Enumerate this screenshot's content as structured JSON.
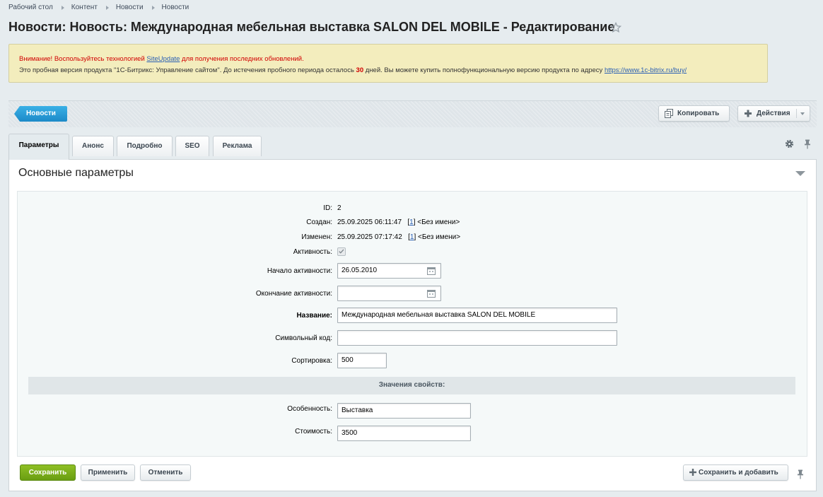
{
  "breadcrumb": [
    "Рабочий стол",
    "Контент",
    "Новости",
    "Новости"
  ],
  "page_title": "Новости: Новость: Международная мебельная выставка SALON DEL MOBILE - Редактирование",
  "notice": {
    "warning_prefix": "Внимание! Воспользуйтесь технологией ",
    "warning_link": "SiteUpdate",
    "warning_suffix": " для получения последних обновлений.",
    "info_prefix": "Это пробная версия продукта \"1С-Битрикс: Управление сайтом\". До истечения пробного периода осталось ",
    "days": "30",
    "info_middle": " дней. Вы можете купить полнофункциональную версию продукта по адресу ",
    "info_link": "https://www.1c-bitrix.ru/buy/"
  },
  "toolbar": {
    "back_label": "Новости",
    "copy_label": "Копировать",
    "actions_label": "Действия"
  },
  "tabs": [
    "Параметры",
    "Анонс",
    "Подробно",
    "SEO",
    "Реклама"
  ],
  "section_title": "Основные параметры",
  "form": {
    "id_label": "ID:",
    "id_value": "2",
    "created_label": "Создан:",
    "created_date": "25.09.2025 06:11:47",
    "created_user_link": "1",
    "created_user": "<Без имени>",
    "modified_label": "Изменен:",
    "modified_date": "25.09.2025 07:17:42",
    "modified_user_link": "1",
    "modified_user": "<Без имени>",
    "active_label": "Активность:",
    "active_checked": true,
    "start_label": "Начало активности:",
    "start_value": "26.05.2010",
    "end_label": "Окончание активности:",
    "end_value": "",
    "name_label": "Название:",
    "name_value": "Международная мебельная выставка SALON DEL MOBILE",
    "code_label": "Символьный код:",
    "code_value": "",
    "sort_label": "Сортировка:",
    "sort_value": "500",
    "props_header": "Значения свойств:",
    "feature_label": "Особенность:",
    "feature_value": "Выставка",
    "price_label": "Стоимость:",
    "price_value": "3500"
  },
  "footer": {
    "save_label": "Сохранить",
    "apply_label": "Применить",
    "cancel_label": "Отменить",
    "save_add_label": "Сохранить и добавить"
  },
  "colors": {
    "back_button": "#1c8ac8",
    "save_button": "#6a9e12",
    "notice_bg": "#f3edbd",
    "warning_text": "#d10000"
  }
}
